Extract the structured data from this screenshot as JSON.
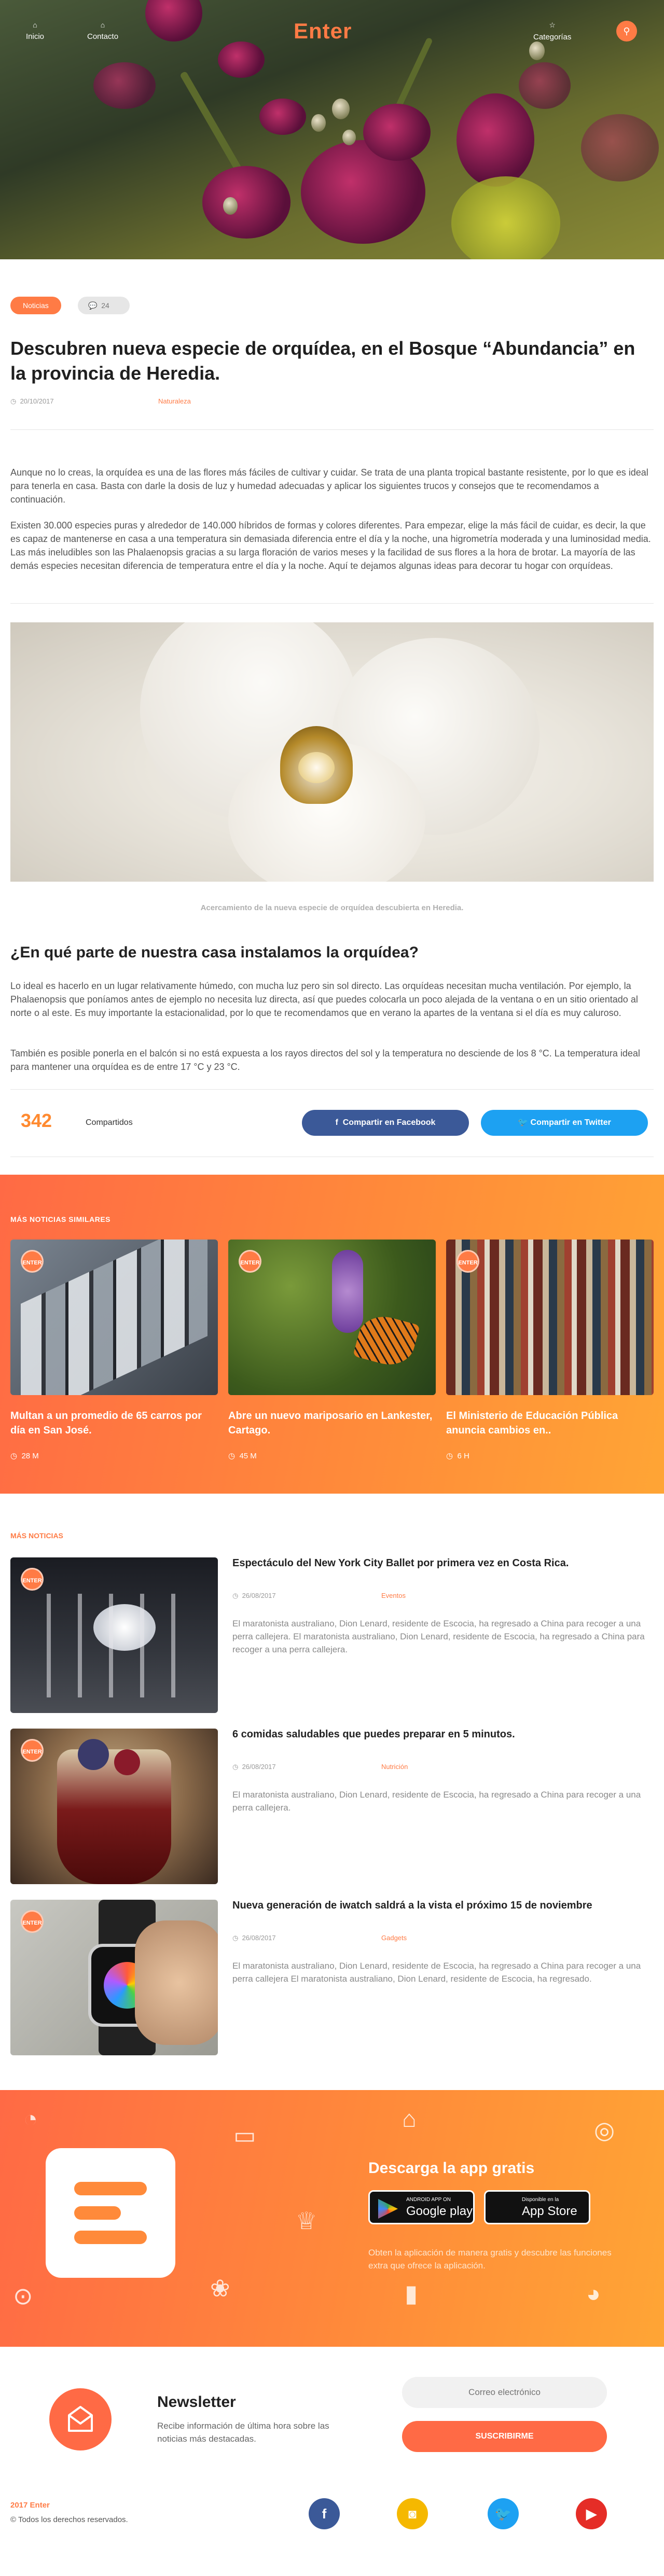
{
  "nav": {
    "home_label": "Inicio",
    "contact_label": "Contacto",
    "brand": "Enter",
    "categories_label": "Categorías"
  },
  "article": {
    "tag": "Noticias",
    "comments": "24",
    "title": "Descubren nueva especie de orquídea, en el Bosque “Abundancia” en la provincia de Heredia.",
    "date": "20/10/2017",
    "category": "Naturaleza",
    "p1": "Aunque no lo creas, la orquídea es una de las flores más fáciles de cultivar y cuidar. Se trata de una planta tropical bastante resistente, por lo que es ideal para tenerla en casa. Basta con darle la dosis de luz y humedad adecuadas y aplicar los siguientes trucos y consejos que te recomendamos a continuación.",
    "p2": "Existen 30.000 especies puras y alrededor de 140.000 híbridos de formas y colores diferentes. Para empezar, elige la más fácil de cuidar, es decir, la que es capaz de mantenerse en casa a una temperatura sin demasiada diferencia entre el día y la noche, una higrometría moderada y una luminosidad media. Las más ineludibles son las Phalaenopsis gracias a su larga floración de varios meses y la facilidad de sus flores a la hora de brotar. La mayoría de las demás especies necesitan diferencia de temperatura entre el día y la noche. Aquí te dejamos algunas ideas para decorar tu hogar con orquídeas.",
    "caption": "Acercamiento de la nueva especie de orquídea descubierta en Heredia.",
    "subtitle": "¿En qué parte de nuestra casa instalamos la orquídea?",
    "p3": "Lo ideal es hacerlo en un lugar relativamente húmedo, con mucha luz pero sin sol directo. Las orquídeas necesitan mucha ventilación. Por ejemplo, la Phalaenopsis que poníamos antes de ejemplo no necesita luz directa, así que puedes colocarla un poco alejada de la ventana o en un sitio orientado al norte o al este. Es muy importante la estacionalidad, por lo que te recomendamos que en verano la apartes de la ventana si el día es muy caluroso.",
    "p4": "También es posible ponerla en el balcón si no está expuesta a los rayos directos del sol y la temperatura no desciende de los 8 °C. La temperatura ideal para mantener una orquídea es de entre 17 °C y 23 °C."
  },
  "share": {
    "count": "342",
    "label": "Compartidos",
    "facebook": "Compartir en Facebook",
    "twitter": "Compartir en Twitter"
  },
  "related": {
    "label": "MÁS NOTICIAS SIMILARES",
    "badge": "ENTER",
    "items": [
      {
        "title": "Multan a un promedio de 65 carros por día en San José.",
        "time": "28 M"
      },
      {
        "title": "Abre un nuevo mariposario en Lankester, Cartago.",
        "time": "45 M"
      },
      {
        "title": "El Ministerio de Educación Pública anuncia cambios en..",
        "time": "6 H"
      }
    ]
  },
  "more": {
    "label": "MÁS NOTICIAS",
    "items": [
      {
        "title": "Espectáculo del New York City Ballet por primera vez en Costa Rica.",
        "date": "26/08/2017",
        "category": "Eventos",
        "excerpt": "El maratonista australiano, Dion Lenard, residente de Escocia, ha regresado a China para recoger a una perra callejera. El maratonista australiano, Dion Lenard, residente de Escocia, ha regresado a China para recoger a una perra callejera."
      },
      {
        "title": "6 comidas saludables que puedes preparar en 5 minutos.",
        "date": "26/08/2017",
        "category": "Nutrición",
        "excerpt": "El maratonista australiano, Dion Lenard, residente de Escocia, ha regresado a China para recoger a una perra callejera."
      },
      {
        "title": "Nueva generación de iwatch saldrá a la vista el próximo 15 de noviembre",
        "date": "26/08/2017",
        "category": "Gadgets",
        "excerpt": "El maratonista australiano, Dion Lenard, residente de Escocia, ha regresado a China para recoger a una perra callejera El maratonista australiano, Dion Lenard, residente de Escocia, ha regresado."
      }
    ]
  },
  "app": {
    "title": "Descarga la app gratis",
    "google_small": "ANDROID APP ON",
    "google_big": "Google play",
    "apple_small": "Disponible en la",
    "apple_big": "App Store",
    "description": "Obten la aplicación de manera gratis y descubre las funciones extra que ofrece la aplicación."
  },
  "newsletter": {
    "title": "Newsletter",
    "description": "Recibe información de última hora sobre las noticias más destacadas.",
    "email_placeholder": "Correo electrónico",
    "subscribe": "SUSCRIBIRME"
  },
  "footer": {
    "brand_year": "2017 Enter",
    "rights": "© Todos los derechos reservados."
  },
  "colors": {
    "accent": "#ff7b45",
    "facebook": "#3b5998",
    "twitter": "#1da1f2",
    "instagram": "#f5b800",
    "youtube": "#e52d27"
  }
}
